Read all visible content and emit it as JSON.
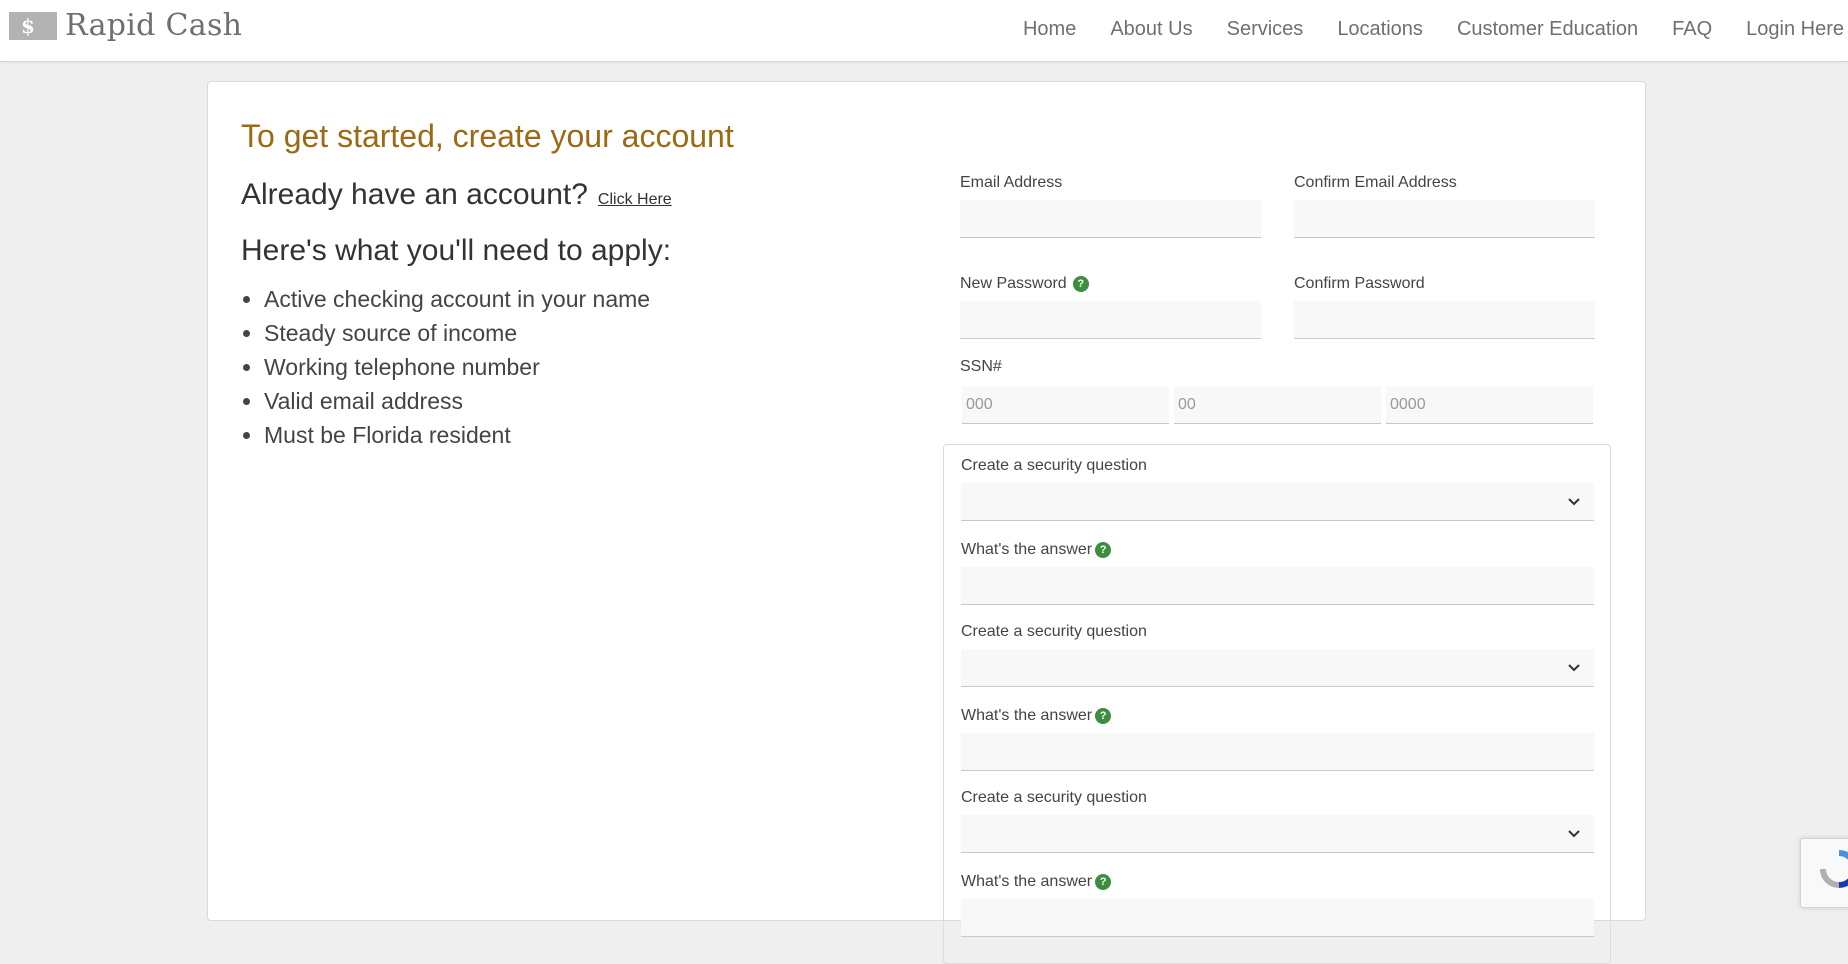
{
  "header": {
    "logo_mark": "$",
    "logo_text": "Rapid Cash",
    "nav": [
      "Home",
      "About Us",
      "Services",
      "Locations",
      "Customer Education",
      "FAQ",
      "Login Here"
    ]
  },
  "intro": {
    "title": "To get started, create your account",
    "already_text": "Already have an account?",
    "already_link": "Click Here",
    "need_heading": "Here's what you'll need to apply:",
    "requirements": [
      "Active checking account in your name",
      "Steady source of income",
      "Working telephone number",
      "Valid email address",
      "Must be  Florida resident"
    ]
  },
  "form": {
    "email_label": "Email Address",
    "email_value": "",
    "confirm_email_label": "Confirm  Email Address",
    "confirm_email_value": "",
    "password_label": "New Password",
    "password_value": "",
    "confirm_password_label": "Confirm Password",
    "confirm_password_value": "",
    "ssn_label": "SSN#",
    "ssn_placeholders": [
      "000",
      "00",
      "0000"
    ],
    "help_glyph": "?",
    "security": [
      {
        "question_label": "Create a security question",
        "question_value": "",
        "answer_label": "What's the answer",
        "answer_value": ""
      },
      {
        "question_label": "Create a security question",
        "question_value": "",
        "answer_label": "What's the answer",
        "answer_value": ""
      },
      {
        "question_label": "Create a security question",
        "question_value": "",
        "answer_label": "What's the answer",
        "answer_value": ""
      }
    ]
  },
  "colors": {
    "title": "#9b6a12",
    "help_badge": "#3c8d3f",
    "background": "#efefef"
  }
}
